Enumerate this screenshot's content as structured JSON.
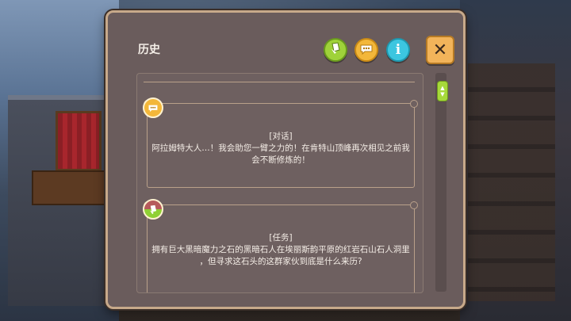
{
  "header": {
    "title": "历史",
    "buttons": [
      {
        "icon": "quest-icon"
      },
      {
        "icon": "dialog-icon"
      },
      {
        "icon": "info-icon",
        "glyph": "i"
      },
      {
        "icon": "close-icon",
        "glyph": "✕"
      }
    ]
  },
  "entries": [
    {
      "type": "dialog",
      "tag": "[对话]",
      "lines": [
        "阿拉姆特大人…！我会助您一臂之力的！在肯特山顶峰再次相见之前我",
        "会不断修炼的！"
      ]
    },
    {
      "type": "quest",
      "tag": "[任务]",
      "lines": [
        "拥有巨大黑暗魔力之石的黑暗石人在埃丽斯韵平原的红岩石山石人洞里",
        "，但寻求这石头的这群家伙到底是什么来历?"
      ]
    }
  ],
  "colors": {
    "panel_bg": "#6a5c5c",
    "panel_border": "#c7a98a",
    "quest_green": "#9fd23a",
    "dialog_yellow": "#f3b73a",
    "info_cyan": "#3cc6e0",
    "close_orange": "#f2b45a"
  }
}
